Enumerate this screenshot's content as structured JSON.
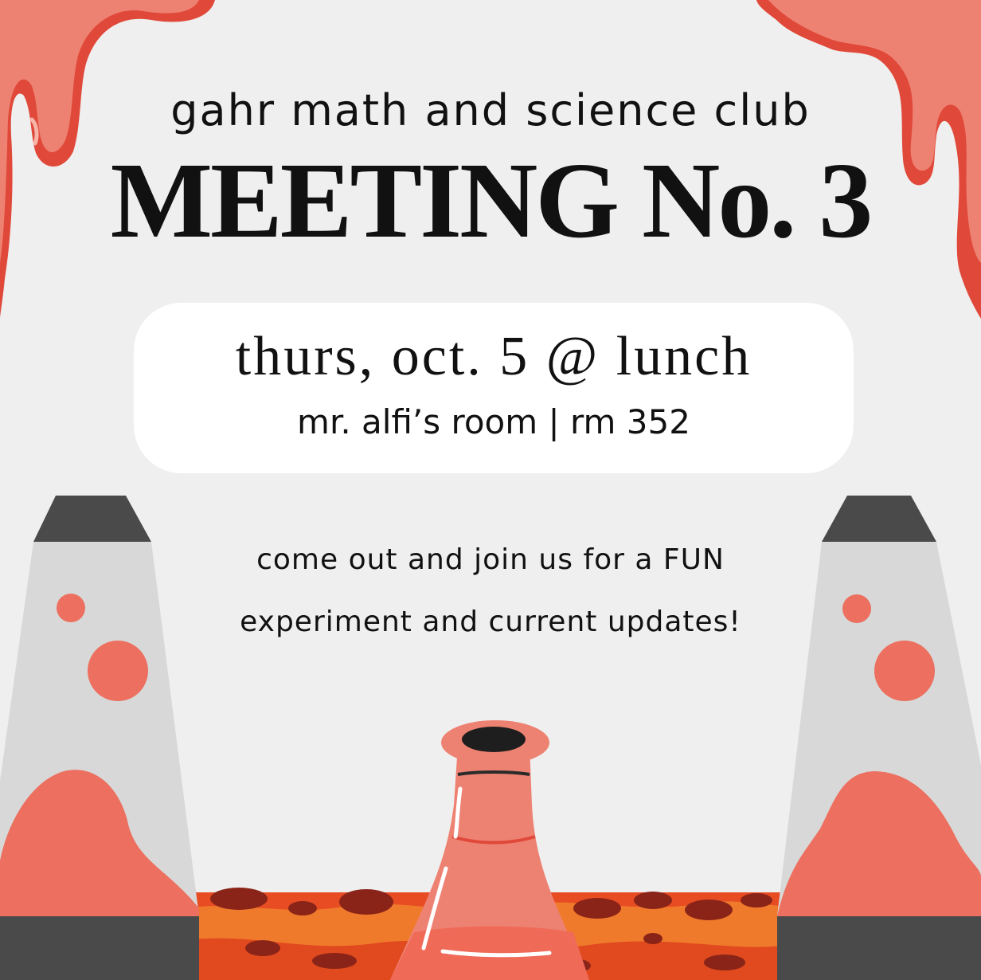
{
  "poster": {
    "subtitle": "gahr math and science club",
    "title": "MEETING No. 3",
    "date_line": "thurs, oct. 5 @ lunch",
    "location_line": "mr. alfi’s room | rm 352",
    "description": "come out and join us for a FUN experiment and current updates!"
  },
  "colors": {
    "background": "#efefef",
    "slime": "#ee8272",
    "slime_dark": "#e0493a",
    "lamp_glass": "#d8d8d8",
    "lamp_cap": "#4a4a4a",
    "lava_floor": "#e84c22"
  },
  "decorations": [
    "slime-drip-left",
    "slime-drip-right",
    "lava-lamp-left",
    "lava-lamp-right",
    "erlenmeyer-flask",
    "lava-floor"
  ]
}
